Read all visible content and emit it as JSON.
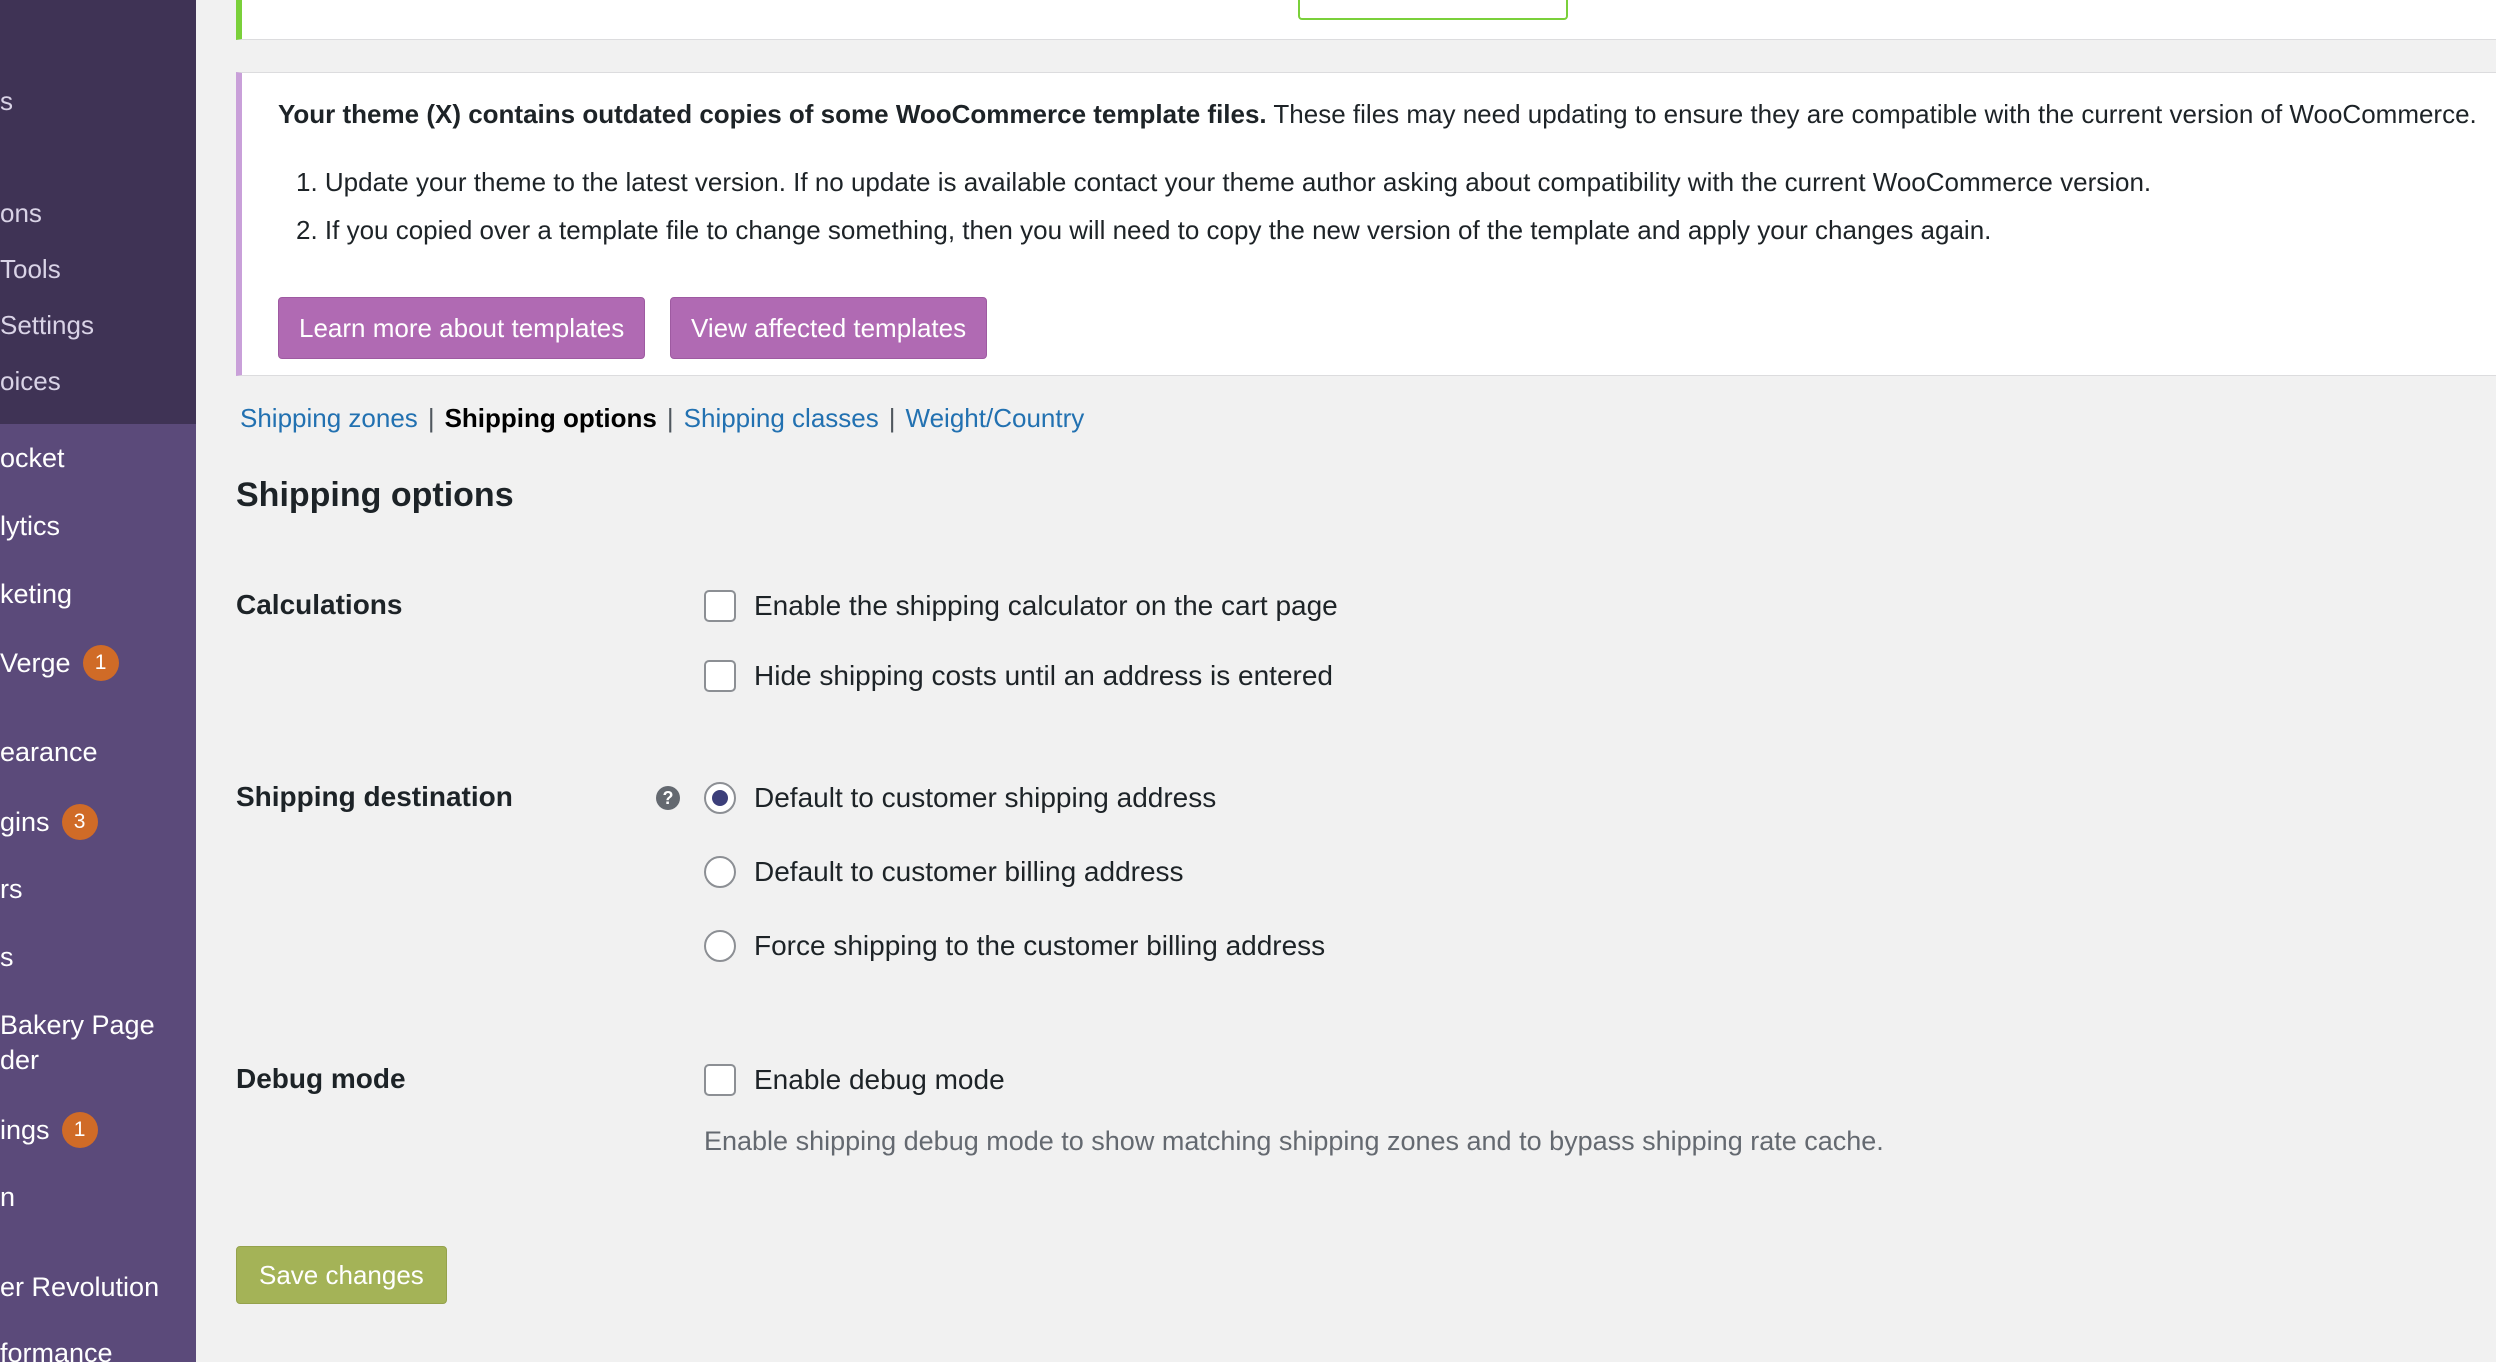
{
  "sidebar": {
    "items": [
      {
        "label": "s",
        "badge": ""
      },
      {
        "label": "ons",
        "badge": ""
      },
      {
        "label": "Tools",
        "badge": ""
      },
      {
        "label": "Settings",
        "badge": ""
      },
      {
        "label": "oices",
        "badge": ""
      },
      {
        "label": "ocket",
        "badge": ""
      },
      {
        "label": "lytics",
        "badge": ""
      },
      {
        "label": "keting",
        "badge": ""
      },
      {
        "label": "Verge",
        "badge": "1"
      },
      {
        "label": "earance",
        "badge": ""
      },
      {
        "label": "gins",
        "badge": "3"
      },
      {
        "label": "rs",
        "badge": ""
      },
      {
        "label": "s",
        "badge": ""
      },
      {
        "label": "Bakery Page",
        "badge": ""
      },
      {
        "label": "der",
        "badge": ""
      },
      {
        "label": "ings",
        "badge": "1"
      },
      {
        "label": "n",
        "badge": ""
      },
      {
        "label": "er Revolution",
        "badge": ""
      },
      {
        "label": "formance",
        "badge": ""
      }
    ]
  },
  "template_notice": {
    "headline_bold": "Your theme (X) contains outdated copies of some WooCommerce template files.",
    "headline_rest": " These files may need updating to ensure they are compatible with the current version of WooCommerce.",
    "steps": [
      "1. Update your theme to the latest version. If no update is available contact your theme author asking about compatibility with the current WooCommerce version.",
      "2. If you copied over a template file to change something, then you will need to copy the new version of the template and apply your changes again."
    ],
    "learn_more_label": "Learn more about templates",
    "view_affected_label": "View affected templates"
  },
  "subnav": {
    "zones": "Shipping zones",
    "options": "Shipping options",
    "classes": "Shipping classes",
    "weight_country": "Weight/Country",
    "separator": "|"
  },
  "section_title": "Shipping options",
  "calculations": {
    "label": "Calculations",
    "enable_calculator": "Enable the shipping calculator on the cart page",
    "hide_costs": "Hide shipping costs until an address is entered"
  },
  "destination": {
    "label": "Shipping destination",
    "help": "?",
    "opt_shipping": "Default to customer shipping address",
    "opt_billing": "Default to customer billing address",
    "opt_force_billing": "Force shipping to the customer billing address"
  },
  "debug": {
    "label": "Debug mode",
    "enable": "Enable debug mode",
    "description": "Enable shipping debug mode to show matching shipping zones and to bypass shipping rate cache."
  },
  "save_label": "Save changes"
}
